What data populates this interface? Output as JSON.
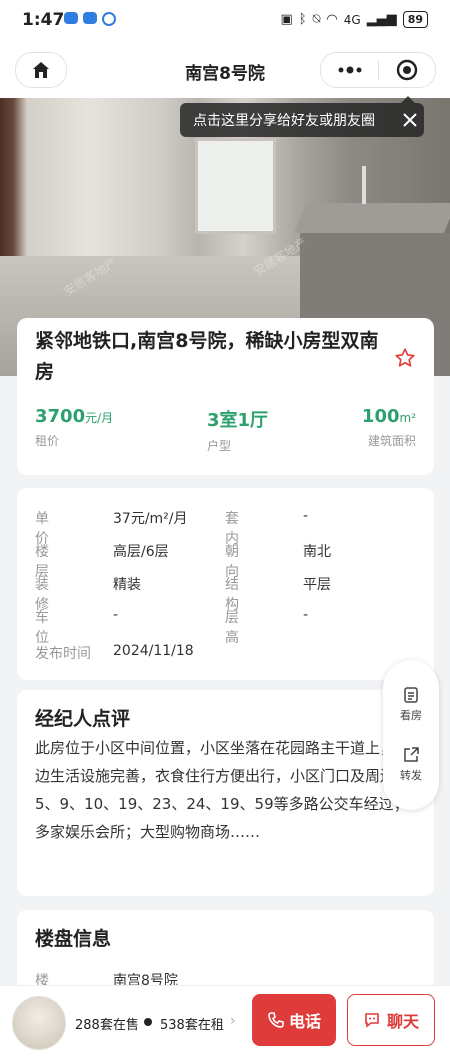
{
  "status_bar": {
    "time": "1:47",
    "signal": "4G",
    "battery": "89"
  },
  "navbar": {
    "title": "南宫8号院"
  },
  "share_tip": {
    "text": "点击这里分享给好友或朋友圈"
  },
  "photo": {
    "watermark": "安居客地产"
  },
  "listing": {
    "title": "紧邻地铁口,南宫8号院，稀缺小房型双南房",
    "stats": [
      {
        "value": "3700",
        "unit": "元/月",
        "label": "租价"
      },
      {
        "value": "3室1厅",
        "unit": "",
        "label": "户型"
      },
      {
        "value": "100",
        "unit": "m²",
        "label": "建筑面积"
      }
    ]
  },
  "details": [
    {
      "label": "单　价",
      "value": "37元/m²/月"
    },
    {
      "label": "套　内",
      "value": "-"
    },
    {
      "label": "楼　层",
      "value": "高层/6层"
    },
    {
      "label": "朝　向",
      "value": "南北"
    },
    {
      "label": "装　修",
      "value": "精装"
    },
    {
      "label": "结　构",
      "value": "平层"
    },
    {
      "label": "车　位",
      "value": "-"
    },
    {
      "label": "层　高",
      "value": "-"
    },
    {
      "label": "发布时间",
      "value": "2024/11/18"
    }
  ],
  "review": {
    "title": "经纪人点评",
    "text": "此房位于小区中间位置，小区坐落在花园路主干道上，周边生活设施完善，衣食住行方便出行，小区门口及周边有5、9、10、19、23、24、19、59等多路公交车经过；多家娱乐会所；大型购物商场……"
  },
  "estate": {
    "title": "楼盘信息",
    "label": "楼盘名称",
    "value": "南宫8号院"
  },
  "side_actions": [
    {
      "label": "看房"
    },
    {
      "label": "转发"
    }
  ],
  "bottom": {
    "for_sale": "288套在售",
    "for_rent": "538套在租",
    "call_label": "电话",
    "chat_label": "聊天"
  }
}
